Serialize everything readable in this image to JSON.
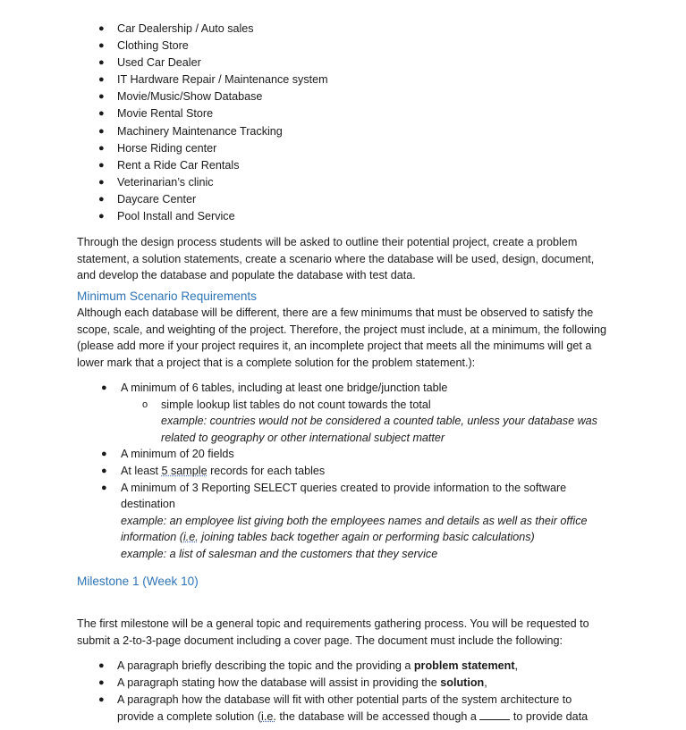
{
  "business_list": [
    "Car Dealership / Auto sales",
    "Clothing Store",
    "Used Car Dealer",
    "IT Hardware Repair / Maintenance system",
    "Movie/Music/Show Database",
    "Movie Rental Store",
    "Machinery Maintenance Tracking",
    "Horse Riding center",
    "Rent a Ride Car Rentals",
    "Veterinarian’s clinic",
    "Daycare Center",
    "Pool Install and Service"
  ],
  "intro_paragraph": "Through the design process students will be asked to outline their potential project, create a problem statement, a solution statements, create a scenario where the database will be used, design, document, and develop the database and populate the database with test data.",
  "min_requirements": {
    "heading": "Minimum Scenario Requirements",
    "paragraph": "Although each database will be different, there are a few minimums that must be observed to satisfy the scope, scale, and weighting of the project.  Therefore, the project must include, at a minimum, the following (please add more if your project requires it, an incomplete project that meets all the minimums will get a lower mark that a project that is a complete solution for the problem statement.):",
    "items": {
      "tables": "A minimum of 6 tables, including at least one bridge/junction table",
      "tables_sub": "simple lookup list tables do not count towards the total",
      "tables_example": "example: countries would not be considered a counted table, unless your database was related to geography or other international subject matter",
      "fields": "A minimum of 20 fields",
      "records_prefix": "At least ",
      "records_flagged": "5  sample",
      "records_suffix": " records for each tables",
      "queries": "A minimum of 3 Reporting SELECT queries created to provide information to the software destination",
      "queries_example1_prefix": "example: an employee list giving both the employees names and details as well as their office information (",
      "queries_example1_flagged": "i.e.",
      "queries_example1_suffix": " joining tables back together again or performing basic calculations)",
      "queries_example2": "example: a list of salesman and the customers that they service"
    }
  },
  "milestone1": {
    "heading": "Milestone 1 (Week 10)",
    "paragraph": "The first milestone will be a general topic and requirements gathering process.  You will be requested to submit a 2-to-3-page document including a cover page.  The document must include the following:",
    "items": {
      "item1_prefix": "A paragraph briefly describing the topic and the providing a ",
      "item1_bold": "problem statement",
      "item1_suffix": ",",
      "item2_prefix": "A paragraph stating how the database will assist in providing the ",
      "item2_bold": "solution",
      "item2_suffix": ",",
      "item3_prefix": "A paragraph how the database will fit with other potential parts of the system architecture to provide a complete solution (",
      "item3_flagged": "i.e.",
      "item3_middle": " the database will be accessed though a ",
      "item3_suffix": " to provide data"
    }
  }
}
